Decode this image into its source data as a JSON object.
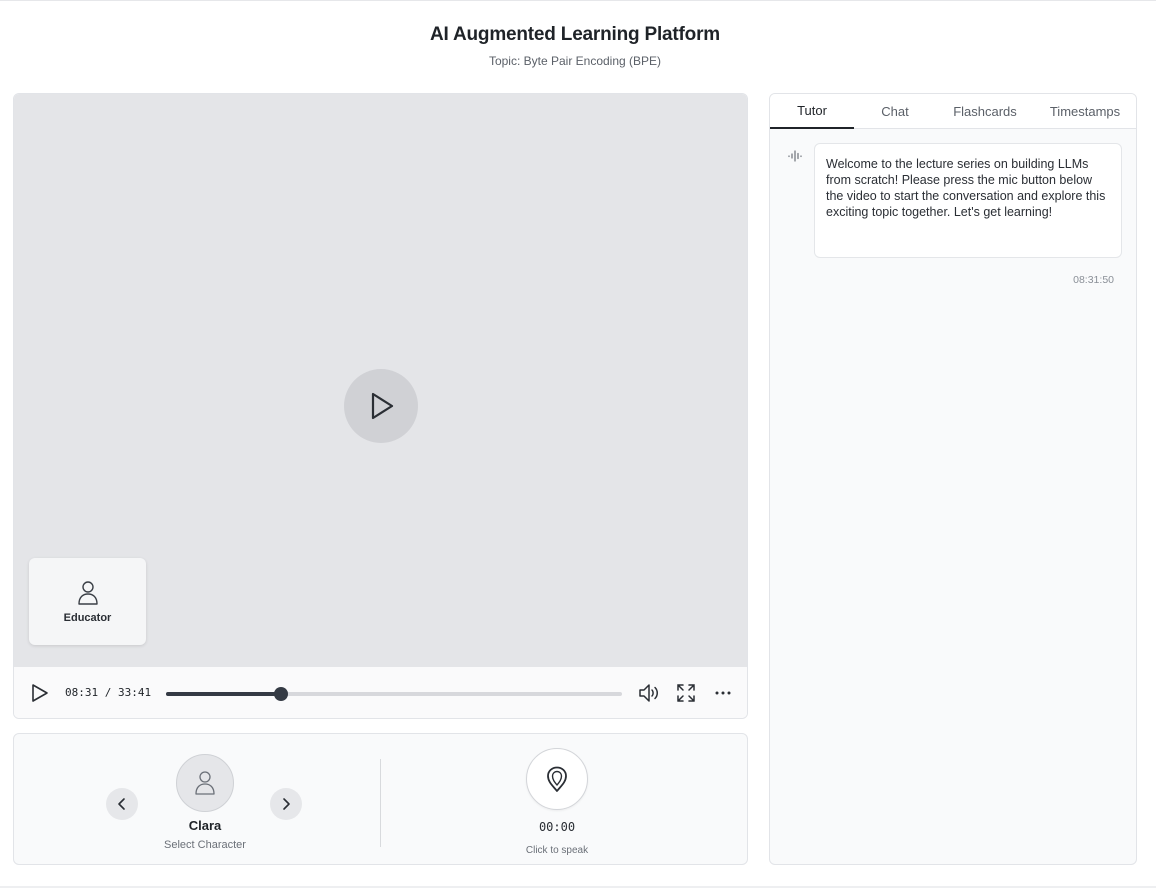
{
  "header": {
    "title": "AI Augmented Learning Platform",
    "subtitle": "Topic: Byte Pair Encoding (BPE)"
  },
  "video": {
    "overlay_label": "Educator",
    "current_time": "08:31",
    "duration": "33:41",
    "time_display": "08:31 / 33:41",
    "progress_fraction": 0.252,
    "icons": [
      "play-icon",
      "volume-icon",
      "fullscreen-icon",
      "more-icon"
    ]
  },
  "character": {
    "name": "Clara",
    "caption": "Select Character"
  },
  "mic": {
    "timer": "00:00",
    "caption": "Click to speak"
  },
  "panel": {
    "tabs": [
      {
        "label": "Tutor",
        "active": true
      },
      {
        "label": "Chat",
        "active": false
      },
      {
        "label": "Flashcards",
        "active": false
      },
      {
        "label": "Timestamps",
        "active": false
      }
    ],
    "messages": [
      {
        "text": "Welcome to the lecture series on building LLMs from scratch! Please press the mic button below the video to start the conversation and explore this exciting topic together. Let's get learning!",
        "time": "08:31:50"
      }
    ]
  },
  "colors": {
    "accent": "#343a44",
    "video_bg": "#e4e5e8",
    "panel_bg": "#f9fafb"
  }
}
